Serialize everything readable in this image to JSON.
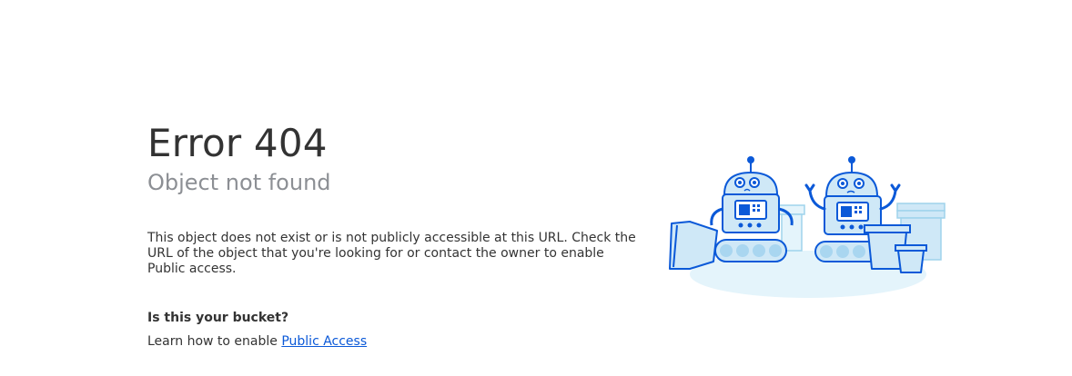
{
  "error": {
    "title": "Error 404",
    "subtitle": "Object not found",
    "description": "This object does not exist or is not publicly accessible at this URL. Check the URL of the object that you're looking for or contact the owner to enable Public access."
  },
  "bucket": {
    "heading": "Is this your bucket?",
    "learn_prefix": "Learn how to enable ",
    "link_label": "Public Access"
  },
  "colors": {
    "text": "#333333",
    "muted": "#8c8f94",
    "link": "#0b59d8",
    "robot_stroke": "#0b59d8",
    "robot_fill": "#cfe8f7",
    "floor": "#e4f4fb"
  }
}
